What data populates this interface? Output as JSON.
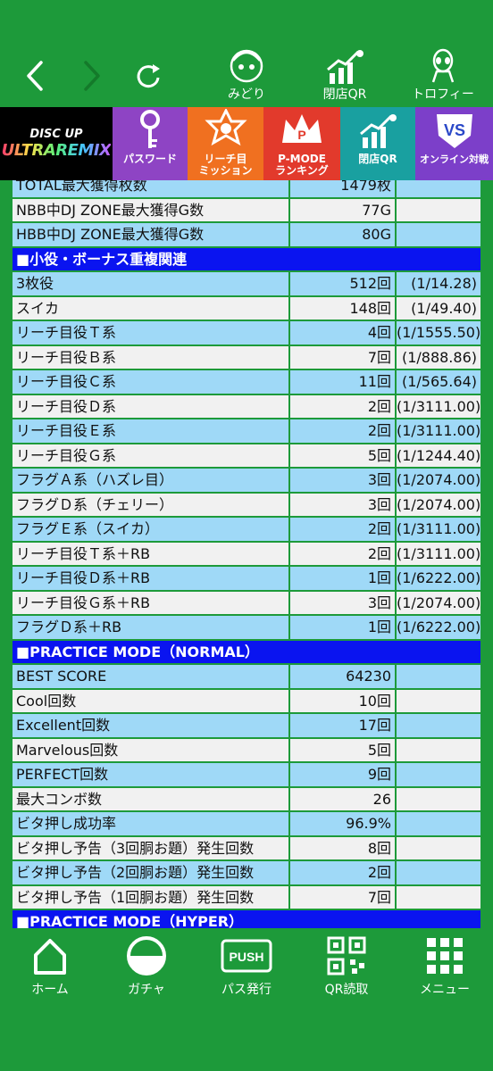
{
  "topnav": {
    "items": [
      {
        "label": "みどり"
      },
      {
        "label": "閉店QR"
      },
      {
        "label": "トロフィー"
      }
    ]
  },
  "banner": {
    "logo_line1": "DISC UP",
    "logo_line2": "ULTRAREMIX",
    "tiles": [
      {
        "label": "パスワード",
        "color": "#8e44c4"
      },
      {
        "label": "リーチ目\nミッション",
        "color": "#f07020"
      },
      {
        "label": "P-MODE\nランキング",
        "color": "#e23a2c"
      },
      {
        "label": "閉店QR",
        "color": "#19a0a0"
      },
      {
        "label": "オンライン対戦",
        "color": "#7c3fc9"
      }
    ]
  },
  "rows": [
    {
      "type": "blue",
      "c1": "TOTAL最大獲得枚数",
      "c2": "1479枚",
      "c3": ""
    },
    {
      "type": "gray",
      "c1": "NBB中DJ ZONE最大獲得G数",
      "c2": "77G",
      "c3": ""
    },
    {
      "type": "blue",
      "c1": "HBB中DJ ZONE最大獲得G数",
      "c2": "80G",
      "c3": ""
    },
    {
      "type": "hdr",
      "c1": "■小役・ボーナス重複関連"
    },
    {
      "type": "blue",
      "c1": "3枚役",
      "c2": "512回",
      "c3": "(1/14.28)"
    },
    {
      "type": "gray",
      "c1": "スイカ",
      "c2": "148回",
      "c3": "(1/49.40)"
    },
    {
      "type": "blue",
      "c1": "リーチ目役Ｔ系",
      "c2": "4回",
      "c3": "(1/1555.50)"
    },
    {
      "type": "gray",
      "c1": "リーチ目役Ｂ系",
      "c2": "7回",
      "c3": "(1/888.86)"
    },
    {
      "type": "blue",
      "c1": "リーチ目役Ｃ系",
      "c2": "11回",
      "c3": "(1/565.64)"
    },
    {
      "type": "gray",
      "c1": "リーチ目役Ｄ系",
      "c2": "2回",
      "c3": "(1/3111.00)"
    },
    {
      "type": "blue",
      "c1": "リーチ目役Ｅ系",
      "c2": "2回",
      "c3": "(1/3111.00)"
    },
    {
      "type": "gray",
      "c1": "リーチ目役Ｇ系",
      "c2": "5回",
      "c3": "(1/1244.40)"
    },
    {
      "type": "blue",
      "c1": "フラグＡ系（ハズレ目）",
      "c2": "3回",
      "c3": "(1/2074.00)"
    },
    {
      "type": "gray",
      "c1": "フラグＤ系（チェリー）",
      "c2": "3回",
      "c3": "(1/2074.00)"
    },
    {
      "type": "blue",
      "c1": "フラグＥ系（スイカ）",
      "c2": "2回",
      "c3": "(1/3111.00)"
    },
    {
      "type": "gray",
      "c1": "リーチ目役Ｔ系＋RB",
      "c2": "2回",
      "c3": "(1/3111.00)"
    },
    {
      "type": "blue",
      "c1": "リーチ目役Ｄ系＋RB",
      "c2": "1回",
      "c3": "(1/6222.00)"
    },
    {
      "type": "gray",
      "c1": "リーチ目役Ｇ系＋RB",
      "c2": "3回",
      "c3": "(1/2074.00)"
    },
    {
      "type": "blue",
      "c1": "フラグＤ系＋RB",
      "c2": "1回",
      "c3": "(1/6222.00)"
    },
    {
      "type": "hdr",
      "c1": "■PRACTICE MODE（NORMAL）"
    },
    {
      "type": "blue",
      "c1": "BEST SCORE",
      "c2": "64230",
      "c3": ""
    },
    {
      "type": "gray",
      "c1": "Cool回数",
      "c2": "10回",
      "c3": ""
    },
    {
      "type": "blue",
      "c1": "Excellent回数",
      "c2": "17回",
      "c3": ""
    },
    {
      "type": "gray",
      "c1": "Marvelous回数",
      "c2": "5回",
      "c3": ""
    },
    {
      "type": "blue",
      "c1": "PERFECT回数",
      "c2": "9回",
      "c3": ""
    },
    {
      "type": "gray",
      "c1": "最大コンボ数",
      "c2": "26",
      "c3": ""
    },
    {
      "type": "blue",
      "c1": "ビタ押し成功率",
      "c2": "96.9%",
      "c3": ""
    },
    {
      "type": "gray",
      "c1": "ビタ押し予告（3回胴お題）発生回数",
      "c2": "8回",
      "c3": ""
    },
    {
      "type": "blue",
      "c1": "ビタ押し予告（2回胴お題）発生回数",
      "c2": "2回",
      "c3": ""
    },
    {
      "type": "gray",
      "c1": "ビタ押し予告（1回胴お題）発生回数",
      "c2": "7回",
      "c3": ""
    },
    {
      "type": "hdr",
      "c1": "■PRACTICE MODE（HYPER）"
    }
  ],
  "bottomnav": {
    "items": [
      {
        "label": "ホーム"
      },
      {
        "label": "ガチャ"
      },
      {
        "label": "パス発行"
      },
      {
        "label": "QR読取"
      },
      {
        "label": "メニュー"
      }
    ]
  }
}
